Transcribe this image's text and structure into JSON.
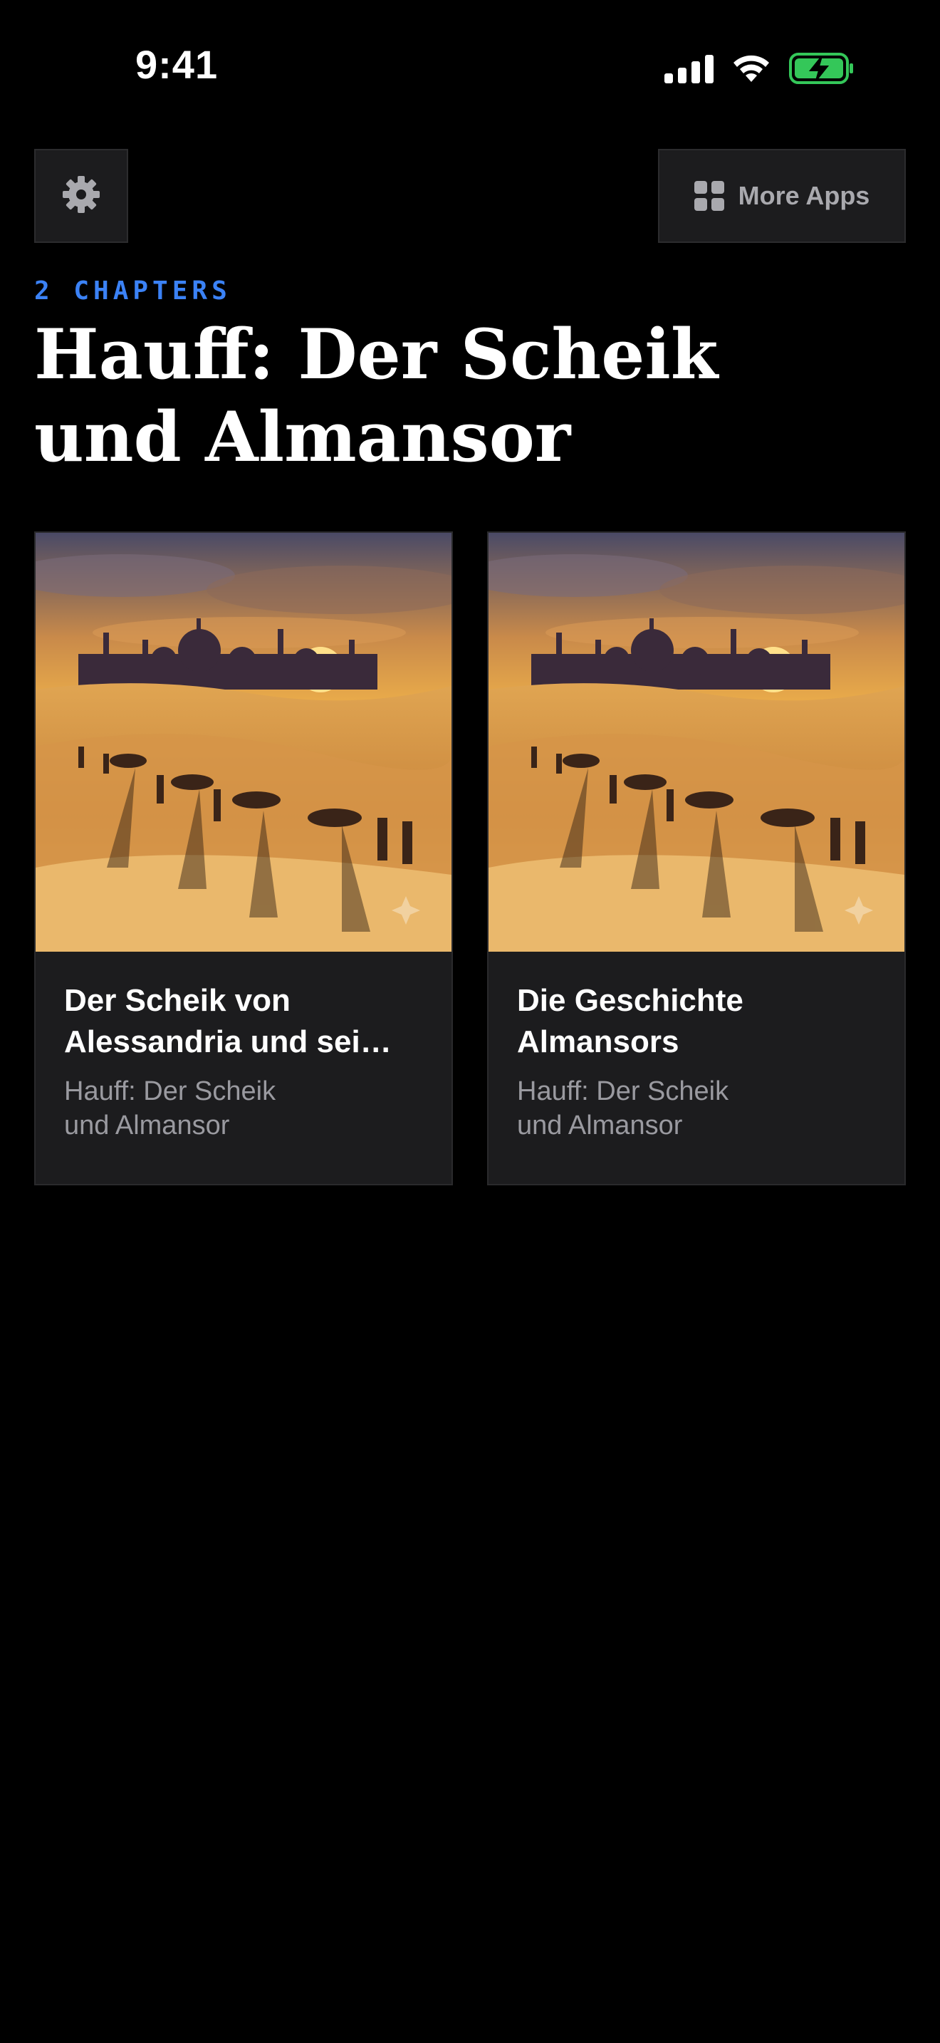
{
  "status_bar": {
    "time": "9:41"
  },
  "header": {
    "more_apps_label": "More Apps"
  },
  "collection": {
    "chapter_count": "2 CHAPTERS",
    "title": "Hauff: Der Scheik und Almansor"
  },
  "chapters": [
    {
      "title": "Der Scheik von Alessandria und sei…",
      "subtitle": "Hauff: Der Scheik und Almansor",
      "image": "desert-caravan-at-sunset"
    },
    {
      "title": "Die Geschichte Almansors",
      "subtitle": "Hauff: Der Scheik und Almansor",
      "image": "desert-caravan-at-sunset"
    }
  ],
  "colors": {
    "background": "#000000",
    "card": "#1c1c1e",
    "accent": "#3b82f6",
    "muted_text": "#9a9aa0",
    "battery": "#34c759"
  },
  "icons": {
    "settings": "gear-icon",
    "more_apps": "grid-icon"
  }
}
